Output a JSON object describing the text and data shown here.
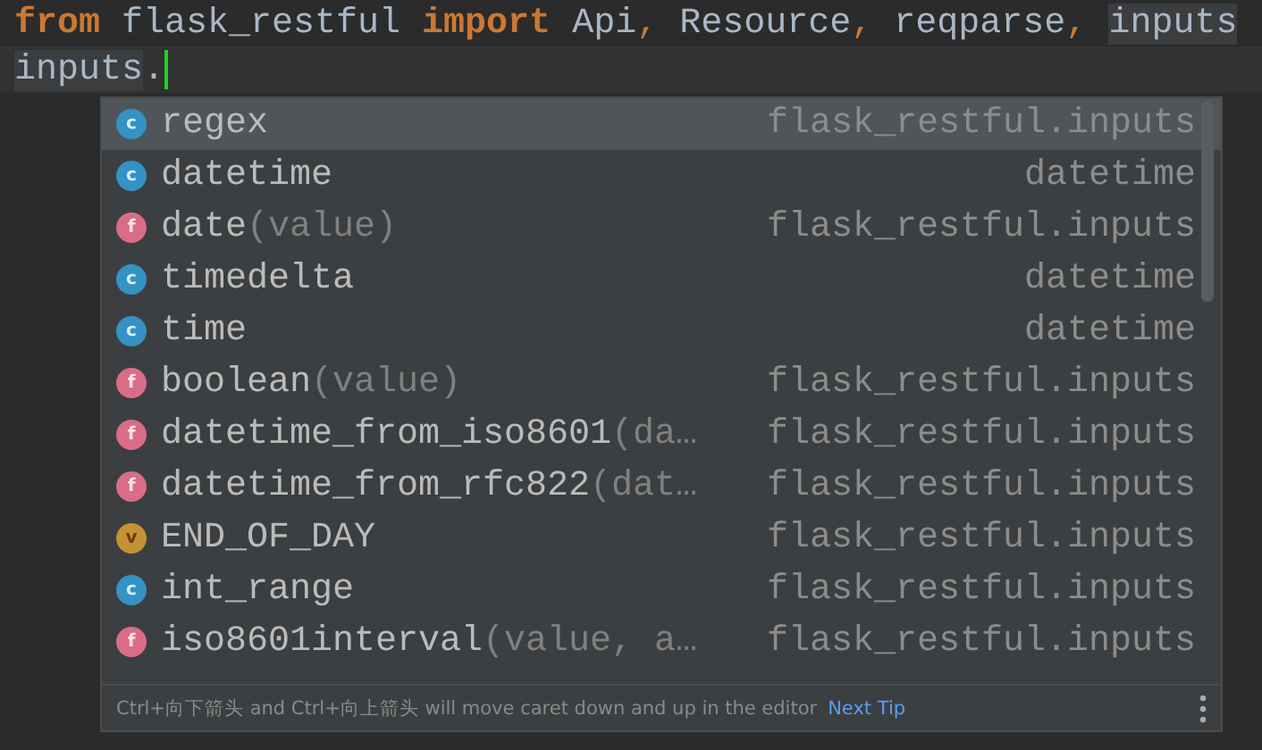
{
  "code_lines": [
    {
      "current": false,
      "segments": [
        {
          "text": "from",
          "kind": "keyword"
        },
        {
          "text": " flask_restful ",
          "kind": "plain"
        },
        {
          "text": "import",
          "kind": "keyword"
        },
        {
          "text": " Api",
          "kind": "plain"
        },
        {
          "text": ",",
          "kind": "punct"
        },
        {
          "text": " Resource",
          "kind": "plain"
        },
        {
          "text": ",",
          "kind": "punct"
        },
        {
          "text": " reqparse",
          "kind": "plain"
        },
        {
          "text": ", ",
          "kind": "punct"
        },
        {
          "text": "inputs",
          "kind": "highlight"
        }
      ]
    },
    {
      "current": true,
      "segments": [
        {
          "text": "inputs",
          "kind": "highlight"
        },
        {
          "text": ".",
          "kind": "plain"
        }
      ]
    }
  ],
  "completion": {
    "items": [
      {
        "kind": "class",
        "badge": "c",
        "name": "regex",
        "type": "flask_restful.inputs",
        "selected": true
      },
      {
        "kind": "class",
        "badge": "c",
        "name": "datetime",
        "type": "datetime",
        "selected": false
      },
      {
        "kind": "function",
        "badge": "f",
        "name": "date",
        "params": "(value)",
        "type": "flask_restful.inputs",
        "selected": false
      },
      {
        "kind": "class",
        "badge": "c",
        "name": "timedelta",
        "type": "datetime",
        "selected": false
      },
      {
        "kind": "class",
        "badge": "c",
        "name": "time",
        "type": "datetime",
        "selected": false
      },
      {
        "kind": "function",
        "badge": "f",
        "name": "boolean",
        "params": "(value)",
        "type": "flask_restful.inputs",
        "selected": false
      },
      {
        "kind": "function",
        "badge": "f",
        "name": "datetime_from_iso8601",
        "params": "(da…",
        "type": "flask_restful.inputs",
        "selected": false
      },
      {
        "kind": "function",
        "badge": "f",
        "name": "datetime_from_rfc822",
        "params": "(dat…",
        "type": "flask_restful.inputs",
        "selected": false
      },
      {
        "kind": "variable",
        "badge": "v",
        "name": "END_OF_DAY",
        "type": "flask_restful.inputs",
        "selected": false
      },
      {
        "kind": "class",
        "badge": "c",
        "name": "int_range",
        "type": "flask_restful.inputs",
        "selected": false
      },
      {
        "kind": "function",
        "badge": "f",
        "name": "iso8601interval",
        "params": "(value, a…",
        "type": "flask_restful.inputs",
        "selected": false
      }
    ],
    "footer": {
      "tip": "Ctrl+向下箭头 and Ctrl+向上箭头 will move caret down and up in the editor",
      "link": "Next Tip"
    }
  }
}
